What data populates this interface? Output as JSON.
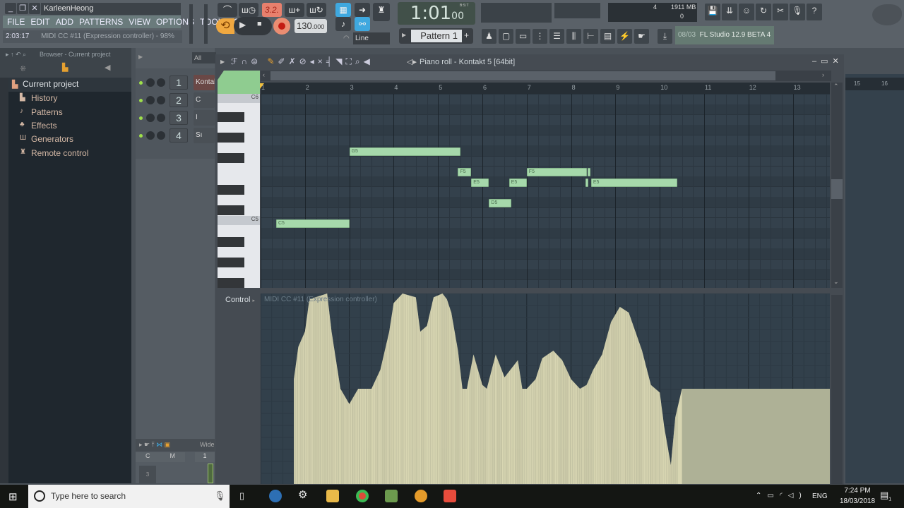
{
  "window": {
    "user": "KarleenHeong",
    "minimize": "_",
    "restore": "❐",
    "close": "✕"
  },
  "menu": [
    "FILE",
    "EDIT",
    "ADD",
    "PATTERNS",
    "VIEW",
    "OPTIONS",
    "TOOLS",
    "?"
  ],
  "hint": {
    "time": "2:03:17",
    "text": "MIDI CC #11 (Expression controller) - 98%"
  },
  "transport": {
    "time_sig": "3.2.",
    "tempo": "130",
    "tempo_decimals": ".000",
    "time": "1:01",
    "time_sub": "00",
    "bst": "B:S:T",
    "snap": "Line",
    "pattern": "Pattern 1"
  },
  "monitor": {
    "cpu": "4",
    "ram": "1911 MB",
    "voices": "0"
  },
  "version": {
    "date": "08/03",
    "name": "FL Studio 12.9 BETA 4"
  },
  "browser": {
    "title": "Browser - Current project",
    "root": "Current project",
    "items": [
      "History",
      "Patterns",
      "Effects",
      "Generators",
      "Remote control"
    ]
  },
  "channel_rack": {
    "filter": "All",
    "channels": [
      {
        "num": "1",
        "name": "Kontakt"
      },
      {
        "num": "2",
        "name": "C"
      },
      {
        "num": "3",
        "name": "I"
      },
      {
        "num": "4",
        "name": "Sı"
      }
    ]
  },
  "mixer": {
    "title": "Wide",
    "cols": [
      "C",
      "M"
    ],
    "track": "1",
    "slot": "3"
  },
  "piano_roll": {
    "title": "Piano roll - Kontakt 5 [64bit]",
    "bars": [
      "1",
      "2",
      "3",
      "4",
      "5",
      "6",
      "7",
      "8",
      "9",
      "10",
      "11",
      "12",
      "13"
    ],
    "right_bars": [
      "15",
      "16"
    ],
    "key_labels": [
      "C6",
      "C5"
    ],
    "notes": [
      {
        "pitch": "C5",
        "start": 1.35,
        "len": 1.65
      },
      {
        "pitch": "G5",
        "start": 3.0,
        "len": 2.5
      },
      {
        "pitch": "F5",
        "start": 5.45,
        "len": 0.3
      },
      {
        "pitch": "E5",
        "start": 5.75,
        "len": 0.4
      },
      {
        "pitch": "D5",
        "start": 6.15,
        "len": 0.5
      },
      {
        "pitch": "E5",
        "start": 6.6,
        "len": 0.4
      },
      {
        "pitch": "F5",
        "start": 7.0,
        "len": 1.35
      },
      {
        "pitch": "",
        "start": 8.38,
        "len": 0.06
      },
      {
        "pitch": "",
        "start": 8.33,
        "len": 0.05
      },
      {
        "pitch": "E5",
        "start": 8.45,
        "len": 1.95
      }
    ],
    "control_label": "Control",
    "controller": "MIDI CC #11 (Expression controller)",
    "cc_profile": [
      [
        1.75,
        0.55
      ],
      [
        1.85,
        0.72
      ],
      [
        2.0,
        0.8
      ],
      [
        2.1,
        0.97
      ],
      [
        2.5,
        1.0
      ],
      [
        2.6,
        0.8
      ],
      [
        2.8,
        0.5
      ],
      [
        3.0,
        0.42
      ],
      [
        3.2,
        0.5
      ],
      [
        3.5,
        0.5
      ],
      [
        3.7,
        0.6
      ],
      [
        3.9,
        0.8
      ],
      [
        4.0,
        0.95
      ],
      [
        4.2,
        1.0
      ],
      [
        4.5,
        0.98
      ],
      [
        4.6,
        0.8
      ],
      [
        4.75,
        0.83
      ],
      [
        4.9,
        0.98
      ],
      [
        5.1,
        1.0
      ],
      [
        5.2,
        0.97
      ],
      [
        5.3,
        0.9
      ],
      [
        5.45,
        0.7
      ],
      [
        5.55,
        0.5
      ],
      [
        5.65,
        0.5
      ],
      [
        5.8,
        0.68
      ],
      [
        5.9,
        0.6
      ],
      [
        6.0,
        0.52
      ],
      [
        6.1,
        0.5
      ],
      [
        6.3,
        0.68
      ],
      [
        6.5,
        0.56
      ],
      [
        6.8,
        0.65
      ],
      [
        6.9,
        0.5
      ],
      [
        7.0,
        0.5
      ],
      [
        7.2,
        0.55
      ],
      [
        7.35,
        0.66
      ],
      [
        7.6,
        0.7
      ],
      [
        7.8,
        0.65
      ],
      [
        8.0,
        0.55
      ],
      [
        8.2,
        0.5
      ],
      [
        8.35,
        0.52
      ],
      [
        8.5,
        0.6
      ],
      [
        8.7,
        0.68
      ],
      [
        8.9,
        0.85
      ],
      [
        9.1,
        0.93
      ],
      [
        9.3,
        0.9
      ],
      [
        9.6,
        0.7
      ],
      [
        9.8,
        0.52
      ],
      [
        10.0,
        0.48
      ],
      [
        10.1,
        0.3
      ],
      [
        10.25,
        0.1
      ],
      [
        10.35,
        0.35
      ],
      [
        10.5,
        0.5
      ],
      [
        13.7,
        0.5
      ]
    ]
  },
  "taskbar": {
    "search": "Type here to search",
    "lang": "ENG",
    "time": "7:24 PM",
    "date": "18/03/2018",
    "notif": "1"
  }
}
